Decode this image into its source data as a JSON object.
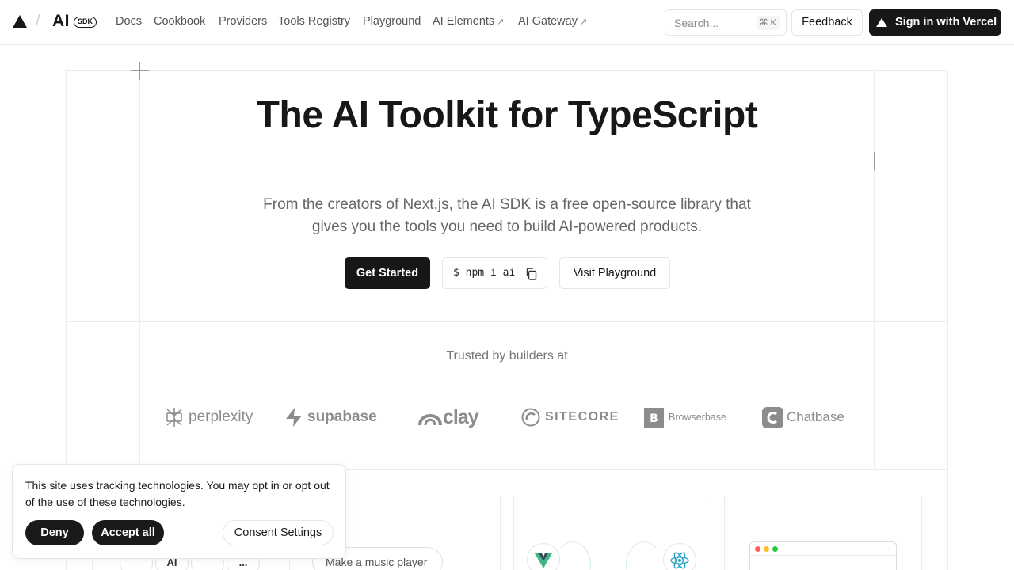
{
  "header": {
    "brand": "AI",
    "brand_badge": "SDK",
    "separator": "/",
    "nav": [
      {
        "label": "Docs"
      },
      {
        "label": "Cookbook"
      },
      {
        "label": "Providers"
      },
      {
        "label": "Tools Registry"
      },
      {
        "label": "Playground"
      },
      {
        "label": "AI Elements",
        "external": true
      },
      {
        "label": "AI Gateway",
        "external": true
      }
    ],
    "search_placeholder": "Search...",
    "search_shortcut": "⌘ K",
    "feedback_label": "Feedback",
    "signin_label": "Sign in with Vercel"
  },
  "hero": {
    "title": "The AI Toolkit for TypeScript",
    "subtitle": "From the creators of Next.js, the AI SDK is a free open-source library that gives you the tools you need to build AI-powered products.",
    "get_started_label": "Get Started",
    "npm_command": "$ npm i ai",
    "playground_label": "Visit Playground"
  },
  "trusted": {
    "heading": "Trusted by builders at",
    "logos": [
      {
        "name": "perplexity",
        "icon": "perplexity-logo-icon"
      },
      {
        "name": "supabase",
        "icon": "supabase-bolt-icon"
      },
      {
        "name": "clay",
        "icon": "clay-logo-icon"
      },
      {
        "name": "SITECORE",
        "icon": "sitecore-logo-icon"
      },
      {
        "name": "Browserbase",
        "icon": "browserbase-b-icon"
      },
      {
        "name": "Chatbase",
        "icon": "chatbase-c-icon"
      }
    ]
  },
  "cards": {
    "prompt_pill": "Make a music player",
    "mini_icons": [
      "",
      "AI",
      "",
      "..."
    ]
  },
  "cookie": {
    "text": "This site uses tracking technologies. You may opt in or opt out of the use of these technologies.",
    "deny_label": "Deny",
    "accept_label": "Accept all",
    "consent_label": "Consent Settings"
  },
  "colors": {
    "primary": "#171717",
    "border": "#ececec",
    "muted_text": "#666666",
    "vue_green": "#41b883",
    "react_blue": "#2a9fc1"
  }
}
